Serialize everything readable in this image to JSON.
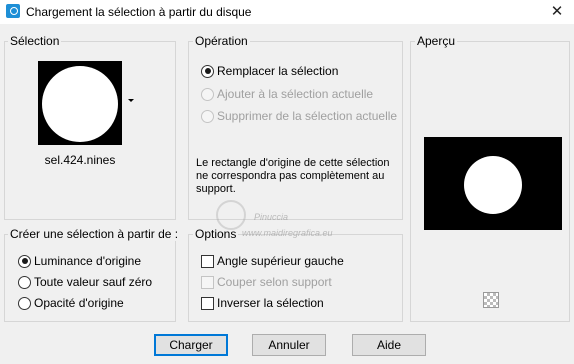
{
  "window": {
    "title": "Chargement la sélection à partir du disque",
    "close_label": "✕"
  },
  "selection": {
    "label": "Sélection",
    "file_name": "sel.424.nines"
  },
  "operation": {
    "label": "Opération",
    "options": [
      {
        "label": "Remplacer la sélection",
        "selected": true,
        "enabled": true
      },
      {
        "label": "Ajouter à la sélection actuelle",
        "selected": false,
        "enabled": false
      },
      {
        "label": "Supprimer de la sélection actuelle",
        "selected": false,
        "enabled": false
      }
    ],
    "note": "Le rectangle d'origine de cette sélection ne correspondra pas complètement au support."
  },
  "preview": {
    "label": "Aperçu"
  },
  "create_from": {
    "label": "Créer une sélection à partir de :",
    "options": [
      {
        "label": "Luminance d'origine",
        "selected": true
      },
      {
        "label": "Toute valeur sauf zéro",
        "selected": false
      },
      {
        "label": "Opacité d'origine",
        "selected": false
      }
    ]
  },
  "options": {
    "label": "Options",
    "items": [
      {
        "label": "Angle supérieur gauche",
        "checked": false,
        "enabled": true
      },
      {
        "label": "Couper selon support",
        "checked": false,
        "enabled": false
      },
      {
        "label": "Inverser la sélection",
        "checked": false,
        "enabled": true
      }
    ]
  },
  "buttons": {
    "load": "Charger",
    "cancel": "Annuler",
    "help": "Aide"
  },
  "watermark": {
    "line1": "Pinuccia",
    "line2": "www.maidiregrafica.eu"
  },
  "colors": {
    "accent": "#0078d7",
    "group_border": "#d6d6d6",
    "background": "#f0f0f0"
  }
}
